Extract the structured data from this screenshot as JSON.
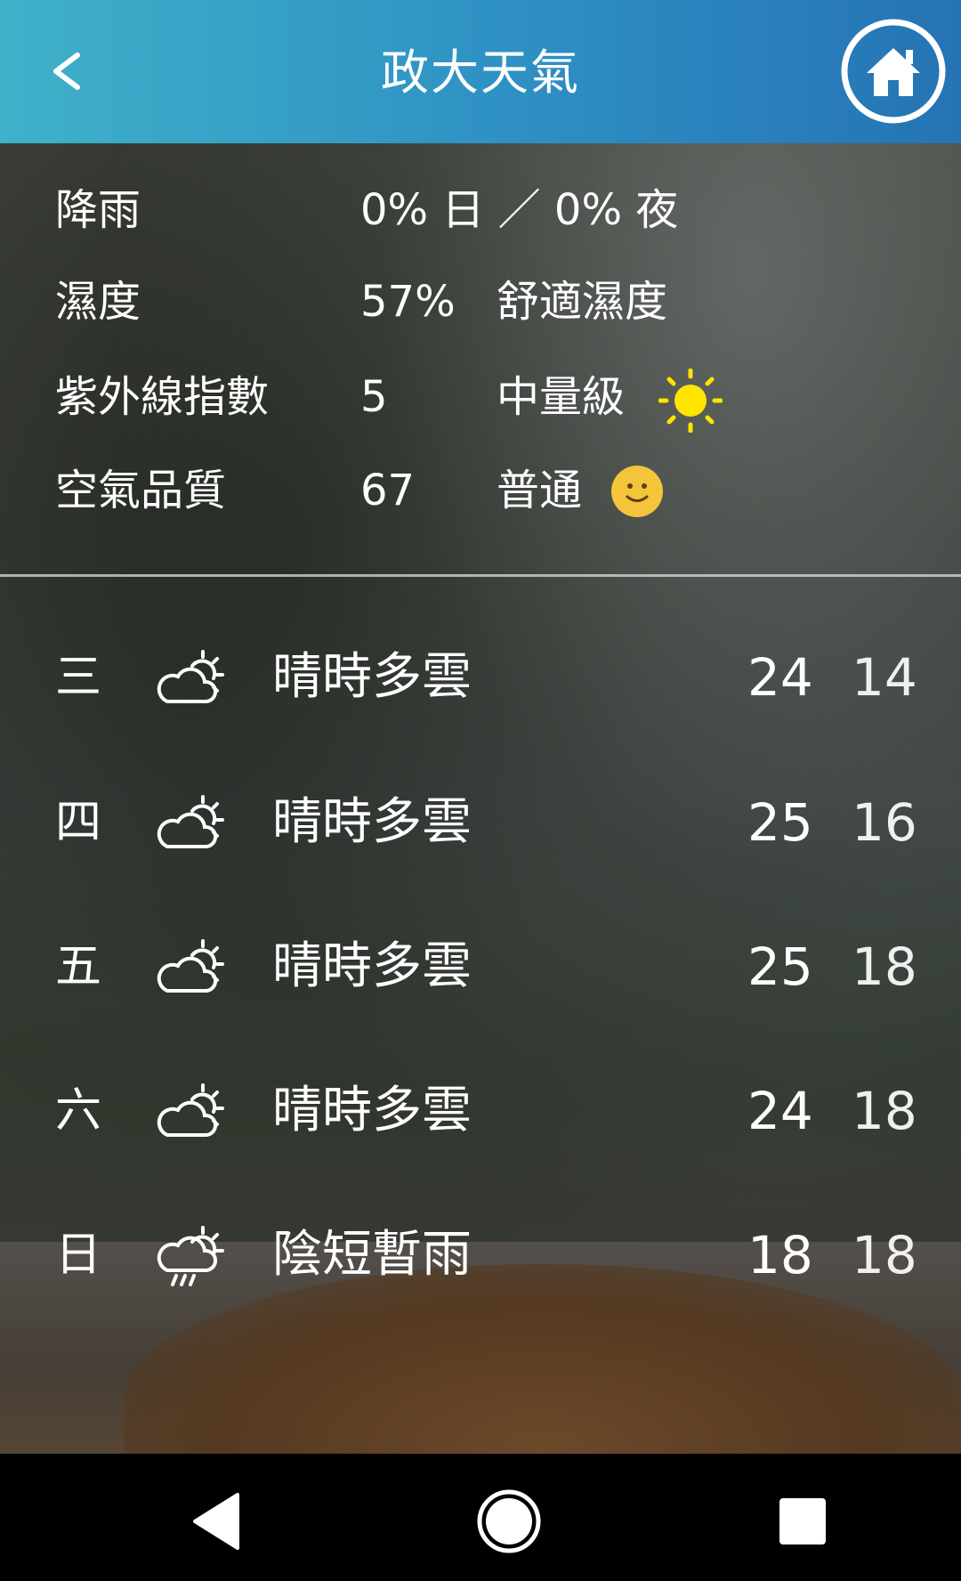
{
  "header": {
    "title": "政大天氣"
  },
  "conditions": {
    "rain": {
      "label": "降雨",
      "value": "0% 日 ／ 0% 夜"
    },
    "humidity": {
      "label": "濕度",
      "value": "57%",
      "desc": "舒適濕度"
    },
    "uv": {
      "label": "紫外線指數",
      "value": "5",
      "desc": "中量級",
      "icon": "sun-icon",
      "icon_color": "#ffe400"
    },
    "aqi": {
      "label": "空氣品質",
      "value": "67",
      "desc": "普通",
      "icon": "smiley-face-icon",
      "icon_color": "#f4c43b"
    }
  },
  "forecast": [
    {
      "day": "三",
      "icon": "partly-cloudy-icon",
      "desc": "晴時多雲",
      "high": "24",
      "low": "14"
    },
    {
      "day": "四",
      "icon": "partly-cloudy-icon",
      "desc": "晴時多雲",
      "high": "25",
      "low": "16"
    },
    {
      "day": "五",
      "icon": "partly-cloudy-icon",
      "desc": "晴時多雲",
      "high": "25",
      "low": "18"
    },
    {
      "day": "六",
      "icon": "partly-cloudy-icon",
      "desc": "晴時多雲",
      "high": "24",
      "low": "18"
    },
    {
      "day": "日",
      "icon": "cloud-rain-icon",
      "desc": "陰短暫雨",
      "high": "18",
      "low": "18"
    }
  ],
  "colors": {
    "header_start": "#3fb1c9",
    "header_end": "#2573b4"
  }
}
